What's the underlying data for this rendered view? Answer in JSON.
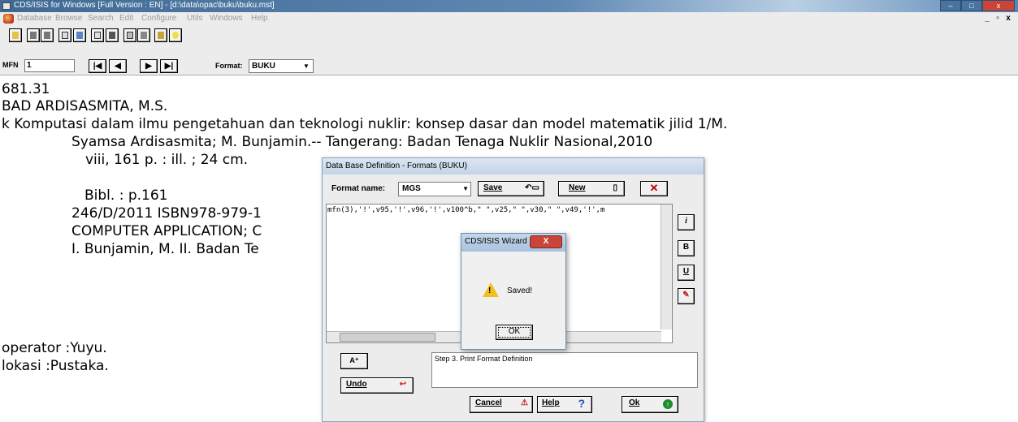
{
  "window": {
    "title": "CDS/ISIS for Windows [Full Version : EN] - [d:\\data\\opac\\buku\\buku.mst]",
    "minimize": "–",
    "maximize": "□",
    "close": "x"
  },
  "menu": {
    "items": [
      "Database",
      "Browse",
      "Search",
      "Edit",
      "Configure",
      "Utils",
      "Windows",
      "Help"
    ],
    "mdi": [
      "_",
      "▫",
      "x"
    ]
  },
  "navbar": {
    "mfn_label": "MFN",
    "mfn_value": "1",
    "first": "|◀",
    "prev": "◀",
    "next": "▶",
    "last": "▶|",
    "format_label": "Format:",
    "format_value": "BUKU"
  },
  "record": {
    "line1": "681.31",
    "line2": "BAD   ARDISASMITA, M.S.",
    "line3": "k        Komputasi dalam ilmu pengetahuan dan teknologi nuklir: konsep dasar dan model matematik jilid 1/M.",
    "line4": "Syamsa Ardisasmita; M. Bunjamin.-- Tangerang: Badan Tenaga Nuklir Nasional,2010",
    "line5": "viii, 161 p. : ill. ; 24 cm.",
    "line6": "Bibl. : p.161",
    "line7": "246/D/2011 ISBN978-979-1",
    "line8": "COMPUTER APPLICATION; C",
    "line9": "I. Bunjamin, M. II. Badan Te",
    "operator": "operator :Yuyu.",
    "lokasi": "lokasi  :Pustaka."
  },
  "dialog": {
    "title": "Data Base Definition - Formats (BUKU)",
    "format_name_label": "Format name:",
    "format_name_value": "MGS",
    "save_label": "Save",
    "new_label": "New",
    "editor_text": "mfn(3),'!',v95,'!',v96,'!',v100^b,\" \",v25,\" \",v30,\" \",v49,'!',m",
    "step_text": "Step 3. Print Format Definition",
    "undo_label": "Undo",
    "cancel_label": "Cancel",
    "help_label": "Help",
    "ok_label": "Ok",
    "side_buttons": [
      "i",
      "B",
      "U"
    ]
  },
  "wizard": {
    "title": "CDS/ISIS Wizard",
    "message": "Saved!",
    "ok_label": "OK",
    "close": "X"
  }
}
